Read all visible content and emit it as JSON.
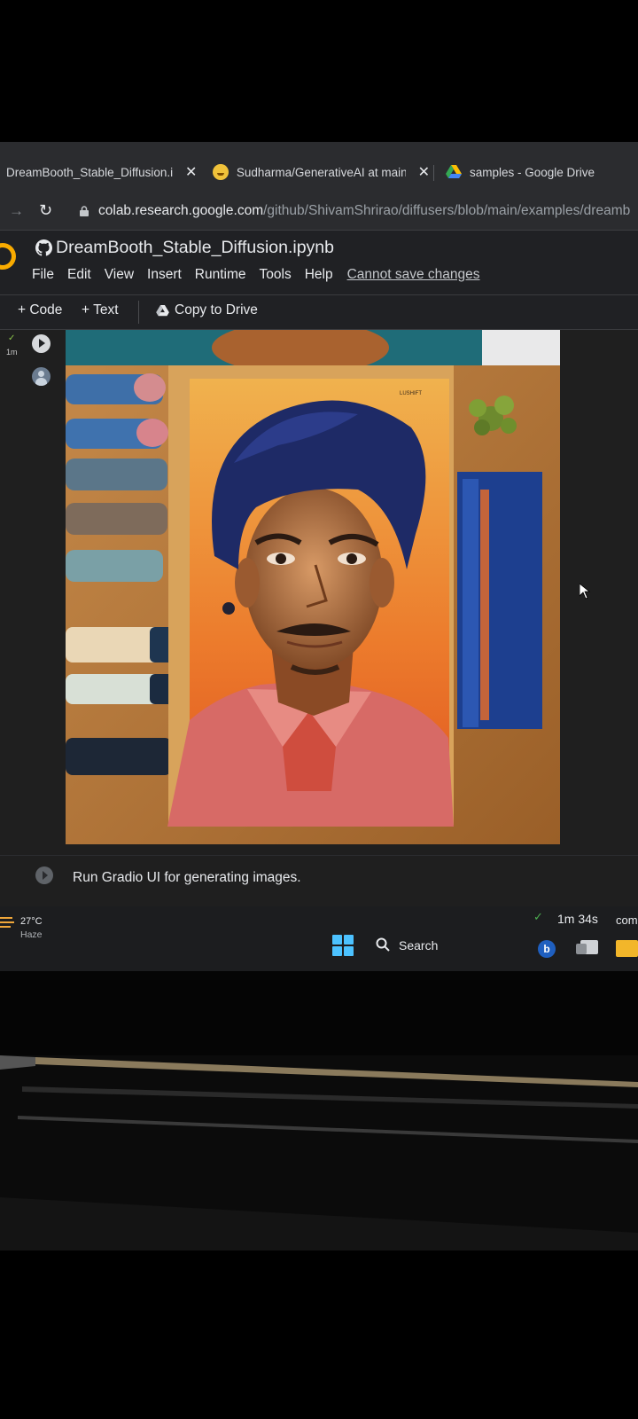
{
  "browser": {
    "tabs": [
      {
        "title": "DreamBooth_Stable_Diffusion.ip",
        "close": "✕"
      },
      {
        "title": "Sudharma/GenerativeAI at main",
        "close": "✕"
      },
      {
        "title": "samples - Google Drive"
      }
    ],
    "url_host": "colab.research.google.com",
    "url_path": "/github/ShivamShrirao/diffusers/blob/main/examples/dreamb"
  },
  "colab": {
    "notebook_title": "DreamBooth_Stable_Diffusion.ipynb",
    "menu": [
      "File",
      "Edit",
      "View",
      "Insert",
      "Runtime",
      "Tools",
      "Help"
    ],
    "save_warning": "Cannot save changes",
    "toolbar": {
      "code": "+ Code",
      "text": "+ Text",
      "copy_drive": "Copy to Drive"
    },
    "cell": {
      "check": "✓",
      "exec_time": "1m"
    },
    "text_cell": "Run Gradio UI for generating images.",
    "status": {
      "check": "✓",
      "time": "1m 34s",
      "more": "com"
    }
  },
  "taskbar": {
    "weather_temp": "27°C",
    "weather_desc": "Haze",
    "search_label": "Search",
    "bing_letter": "b"
  },
  "poster_text": "LUSHIFT"
}
